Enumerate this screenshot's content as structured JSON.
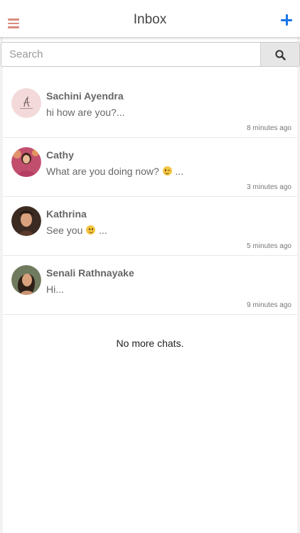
{
  "header": {
    "title": "Inbox",
    "menu_icon": "hamburger-menu-icon",
    "add_icon": "plus-icon"
  },
  "search": {
    "placeholder": "Search",
    "value": "",
    "icon": "search-icon"
  },
  "chats": [
    {
      "name": "Sachini Ayendra",
      "message": "hi how are you?...",
      "time": "8 minutes ago"
    },
    {
      "name": "Cathy",
      "message": "What are you doing now?",
      "message_suffix": "...",
      "emoji": "wink",
      "time": "3 minutes ago"
    },
    {
      "name": "Kathrina",
      "message": "See you",
      "message_suffix": "...",
      "emoji": "smile",
      "time": "5 minutes ago"
    },
    {
      "name": "Senali Rathnayake",
      "message": "Hi...",
      "time": "9 minutes ago"
    }
  ],
  "footer_text": "No more chats.",
  "colors": {
    "menu": "#d98c7e",
    "accent": "#1a75e8",
    "text": "#666666"
  }
}
